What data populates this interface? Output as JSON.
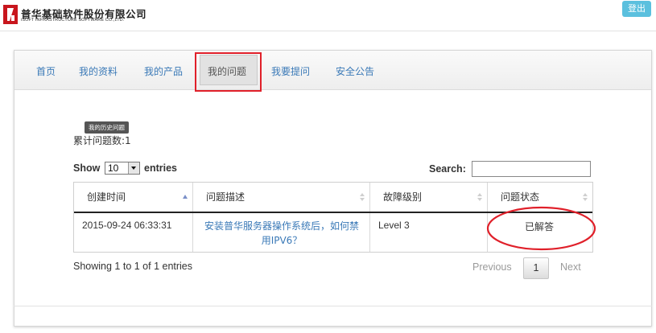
{
  "header": {
    "logo_icon": "company-logo-icon",
    "company_cn": "普华基础软件股份有限公司",
    "company_en": "iSOFT INFRASTRUCTURE SOFTWARE CO.,LTD.",
    "logout_label": "登出",
    "logout_color": "#5bc0de"
  },
  "nav": {
    "items": [
      {
        "label": "首页"
      },
      {
        "label": "我的资料"
      },
      {
        "label": "我的产品"
      },
      {
        "label": "我的问题",
        "active": true
      },
      {
        "label": "我要提问"
      },
      {
        "label": "安全公告"
      }
    ],
    "link_color": "#3a79b7"
  },
  "history": {
    "tooltip": "我的历史问题",
    "count_label": "累计问题数:1"
  },
  "table_controls": {
    "show_label": "Show",
    "page_size": "10",
    "entries_label": "entries",
    "search_label": "Search:",
    "search_value": ""
  },
  "table": {
    "columns": [
      {
        "label": "创建时间",
        "sort": "ascending"
      },
      {
        "label": "问题描述",
        "sort": "none"
      },
      {
        "label": "故障级别",
        "sort": "none"
      },
      {
        "label": "问题状态",
        "sort": "none"
      }
    ],
    "rows": [
      {
        "created": "2015-09-24 06:33:31",
        "description_line1": "安装普华服务器操作系统后，如何禁",
        "description_line2": "用IPV6？",
        "level": "Level 3",
        "status": "已解答"
      }
    ]
  },
  "pagination": {
    "info": "Showing 1 to 1 of 1 entries",
    "previous": "Previous",
    "current": "1",
    "next": "Next"
  },
  "annotation_color": "#e0202a"
}
